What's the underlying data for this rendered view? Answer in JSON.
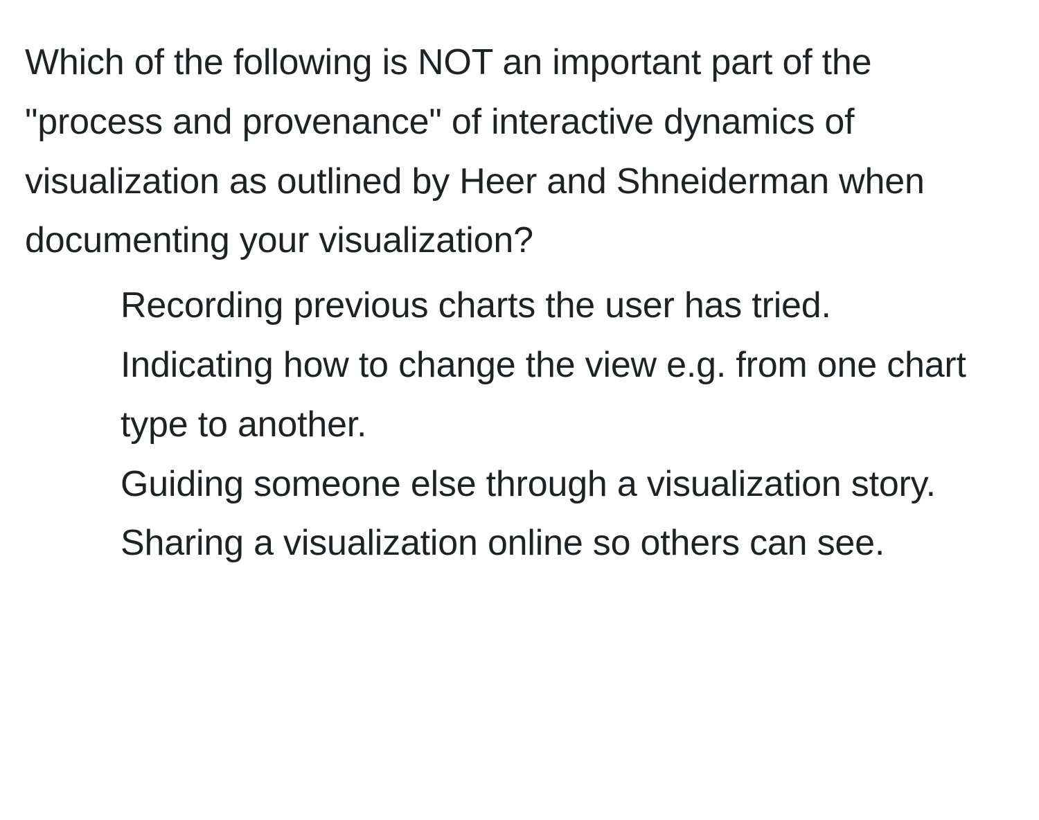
{
  "question": {
    "stem": "Which of the following is NOT an important part of the \"process and provenance\" of interactive dynamics of visualization as outlined by Heer and Shneiderman when documenting your visualization?",
    "options": [
      "Recording previous charts the user has tried.",
      "Indicating how to change the view e.g. from one chart type to another.",
      "Guiding someone else through a visualization story.",
      "Sharing a visualization online so others can see."
    ]
  }
}
